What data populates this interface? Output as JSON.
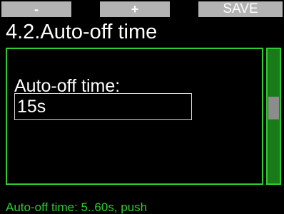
{
  "softkeys": {
    "minus_label": "-",
    "plus_label": "+",
    "save_label": "SAVE"
  },
  "page": {
    "title": "4.2.Auto-off time"
  },
  "setting": {
    "label": "Auto-off time:",
    "value": "15s"
  },
  "scrollbar": {
    "position_fraction": 0.4
  },
  "hint": {
    "text": "Auto-off time: 5..60s, push"
  },
  "colors": {
    "accent": "#2ecc2e",
    "softkey_bg": "#b3b3b3",
    "scroll_track": "#1a7a1a",
    "scroll_thumb": "#8c8c8c",
    "background": "#000000"
  }
}
